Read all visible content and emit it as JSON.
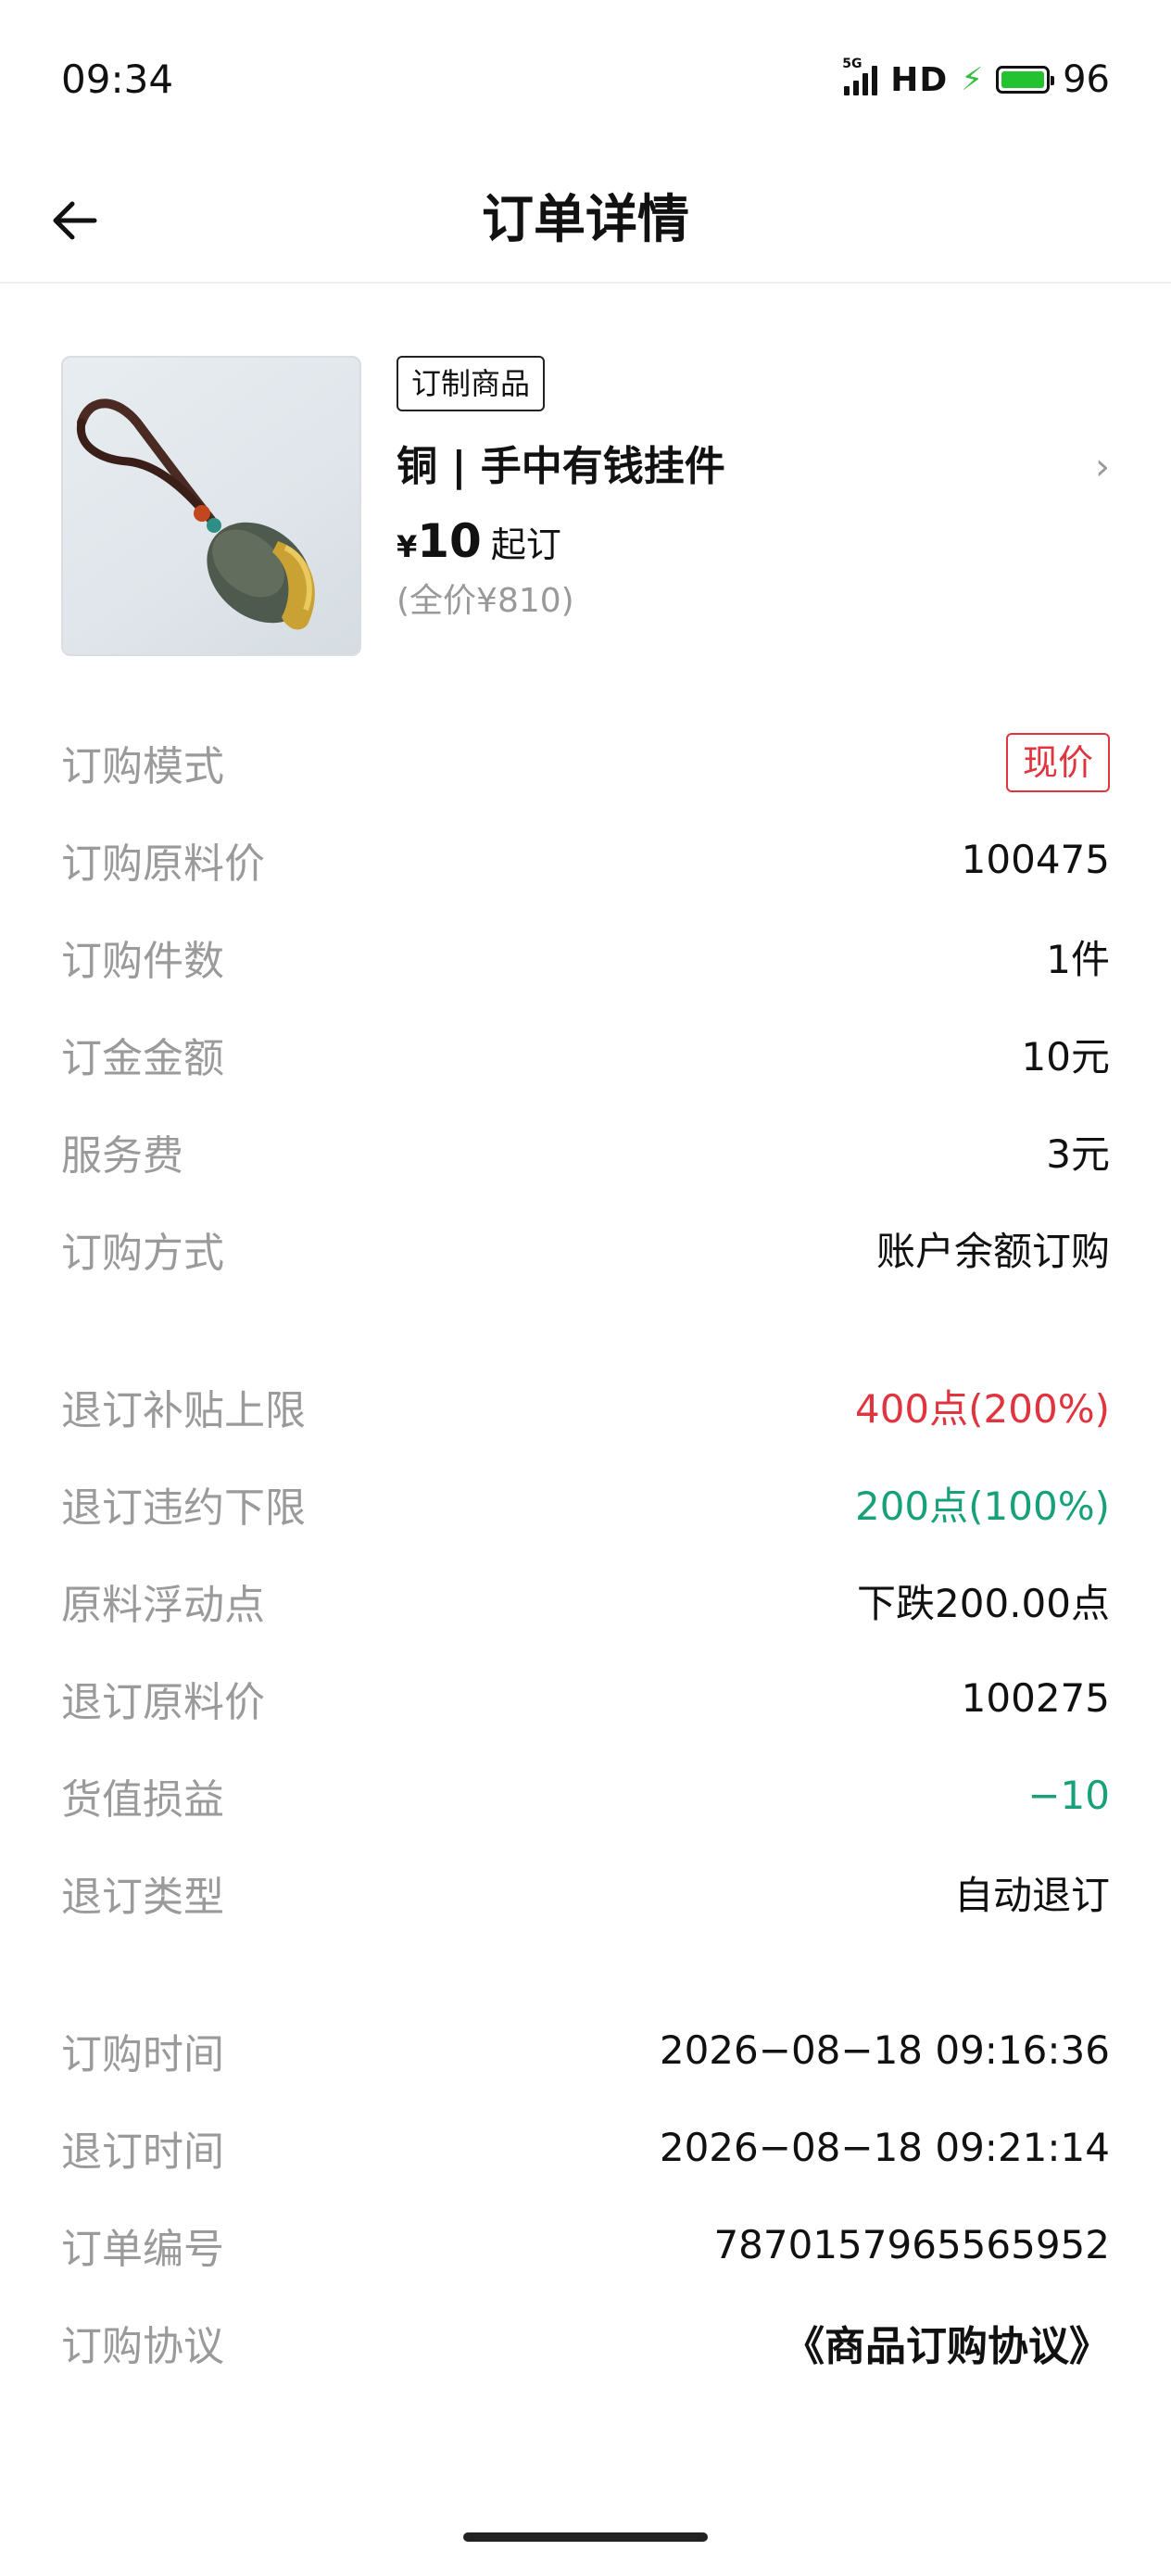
{
  "status_bar": {
    "time": "09:34",
    "network": "5G",
    "hd": "HD",
    "battery": "96"
  },
  "nav": {
    "title": "订单详情"
  },
  "product": {
    "tag": "订制商品",
    "name": "铜 | 手中有钱挂件",
    "currency": "¥",
    "price": "10",
    "price_suffix": "起订",
    "full_price": "(全价¥810)"
  },
  "order_info": [
    {
      "label": "订购模式",
      "value": "现价"
    },
    {
      "label": "订购原料价",
      "value": "100475"
    },
    {
      "label": "订购件数",
      "value": "1件"
    },
    {
      "label": "订金金额",
      "value": "10元"
    },
    {
      "label": "服务费",
      "value": "3元"
    },
    {
      "label": "订购方式",
      "value": "账户余额订购"
    }
  ],
  "settlement_info": [
    {
      "label": "退订补贴上限",
      "value": "400点(200%)"
    },
    {
      "label": "退订违约下限",
      "value": "200点(100%)"
    },
    {
      "label": "原料浮动点",
      "value": "下跌200.00点"
    },
    {
      "label": "退订原料价",
      "value": "100275"
    },
    {
      "label": "货值损益",
      "value": "−10"
    },
    {
      "label": "退订类型",
      "value": "自动退订"
    }
  ],
  "time_info": [
    {
      "label": "订购时间",
      "value": "2026−08−18 09:16:36"
    },
    {
      "label": "退订时间",
      "value": "2026−08−18 09:21:14"
    },
    {
      "label": "订单编号",
      "value": "7870157965565952"
    },
    {
      "label": "订购协议",
      "value": "《商品订购协议》"
    }
  ],
  "colors": {
    "accent_red": "#e0343f",
    "accent_green": "#17a17a",
    "label_gray": "#9a9a9a",
    "battery_green": "#22c32e"
  }
}
